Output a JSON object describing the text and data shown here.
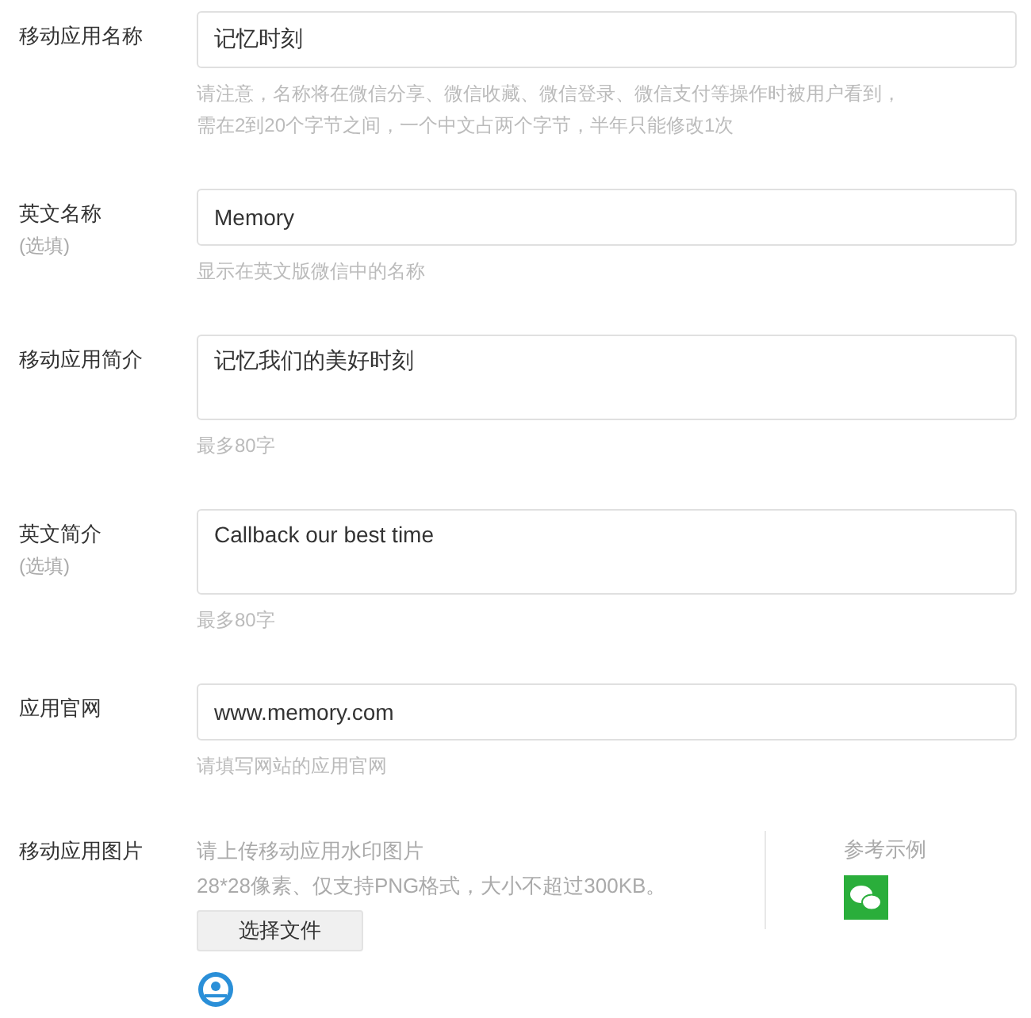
{
  "fields": [
    {
      "kind": "input",
      "label": "移动应用名称",
      "value": "记忆时刻",
      "hints": [
        "请注意，名称将在微信分享、微信收藏、微信登录、微信支付等操作时被用户看到，",
        "需在2到20个字节之间，一个中文占两个字节，半年只能修改1次"
      ]
    },
    {
      "kind": "input",
      "label": "英文名称",
      "optional": "(选填)",
      "value": "Memory",
      "hints": [
        "显示在英文版微信中的名称"
      ]
    },
    {
      "kind": "textarea",
      "label": "移动应用简介",
      "value": "记忆我们的美好时刻",
      "hints": [
        "最多80字"
      ]
    },
    {
      "kind": "textarea",
      "label": "英文简介",
      "optional": "(选填)",
      "value": "Callback our best time",
      "hints": [
        "最多80字"
      ]
    },
    {
      "kind": "input",
      "label": "应用官网",
      "value": "www.memory.com",
      "hints": [
        "请填写网站的应用官网"
      ]
    }
  ],
  "image": {
    "label": "移动应用图片",
    "hints": [
      "请上传移动应用水印图片",
      "28*28像素、仅支持PNG格式，大小不超过300KB。"
    ],
    "button": "选择文件",
    "example_title": "参考示例"
  }
}
